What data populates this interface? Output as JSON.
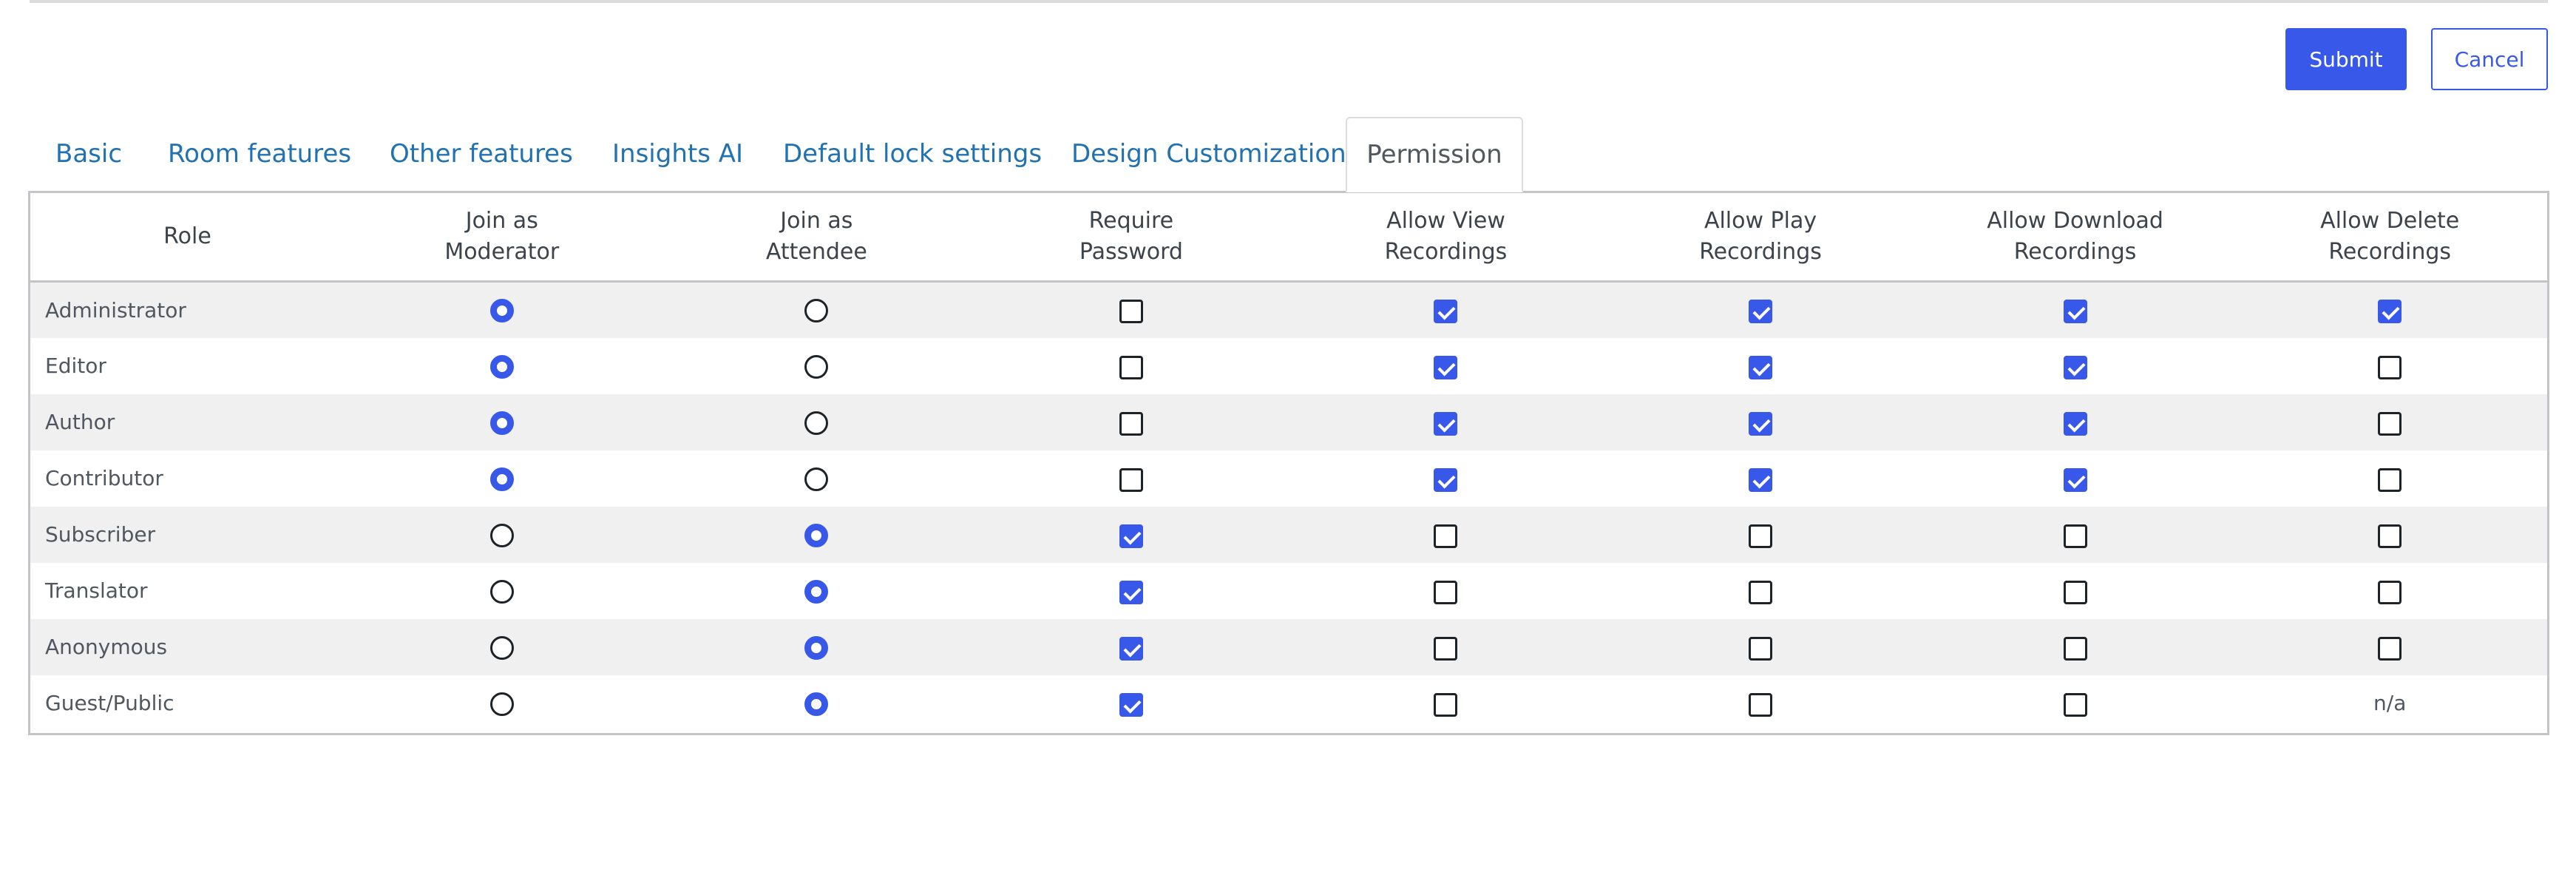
{
  "buttons": {
    "submit": "Submit",
    "cancel": "Cancel"
  },
  "tabs": [
    {
      "label": "Basic",
      "active": false
    },
    {
      "label": "Room features",
      "active": false
    },
    {
      "label": "Other features",
      "active": false
    },
    {
      "label": "Insights AI",
      "active": false
    },
    {
      "label": "Default lock settings",
      "active": false
    },
    {
      "label": "Design Customization",
      "active": false
    },
    {
      "label": "Permission",
      "active": true
    }
  ],
  "colors": {
    "accent": "#3858e9",
    "link": "#2271b1",
    "row_stripe": "#f0f0f1",
    "border": "#c3c4c7"
  },
  "table": {
    "headers": [
      [
        "Role"
      ],
      [
        "Join as",
        "Moderator"
      ],
      [
        "Join as",
        "Attendee"
      ],
      [
        "Require",
        "Password"
      ],
      [
        "Allow View",
        "Recordings"
      ],
      [
        "Allow Play",
        "Recordings"
      ],
      [
        "Allow Download",
        "Recordings"
      ],
      [
        "Allow Delete",
        "Recordings"
      ]
    ],
    "rows": [
      {
        "role": "Administrator",
        "join": "moderator",
        "require_password": false,
        "view": true,
        "play": true,
        "download": true,
        "delete": true
      },
      {
        "role": "Editor",
        "join": "moderator",
        "require_password": false,
        "view": true,
        "play": true,
        "download": true,
        "delete": false
      },
      {
        "role": "Author",
        "join": "moderator",
        "require_password": false,
        "view": true,
        "play": true,
        "download": true,
        "delete": false
      },
      {
        "role": "Contributor",
        "join": "moderator",
        "require_password": false,
        "view": true,
        "play": true,
        "download": true,
        "delete": false
      },
      {
        "role": "Subscriber",
        "join": "attendee",
        "require_password": true,
        "view": false,
        "play": false,
        "download": false,
        "delete": false
      },
      {
        "role": "Translator",
        "join": "attendee",
        "require_password": true,
        "view": false,
        "play": false,
        "download": false,
        "delete": false
      },
      {
        "role": "Anonymous",
        "join": "attendee",
        "require_password": true,
        "view": false,
        "play": false,
        "download": false,
        "delete": false
      },
      {
        "role": "Guest/Public",
        "join": "attendee",
        "require_password": true,
        "view": false,
        "play": false,
        "download": false,
        "delete": "n/a"
      }
    ]
  }
}
